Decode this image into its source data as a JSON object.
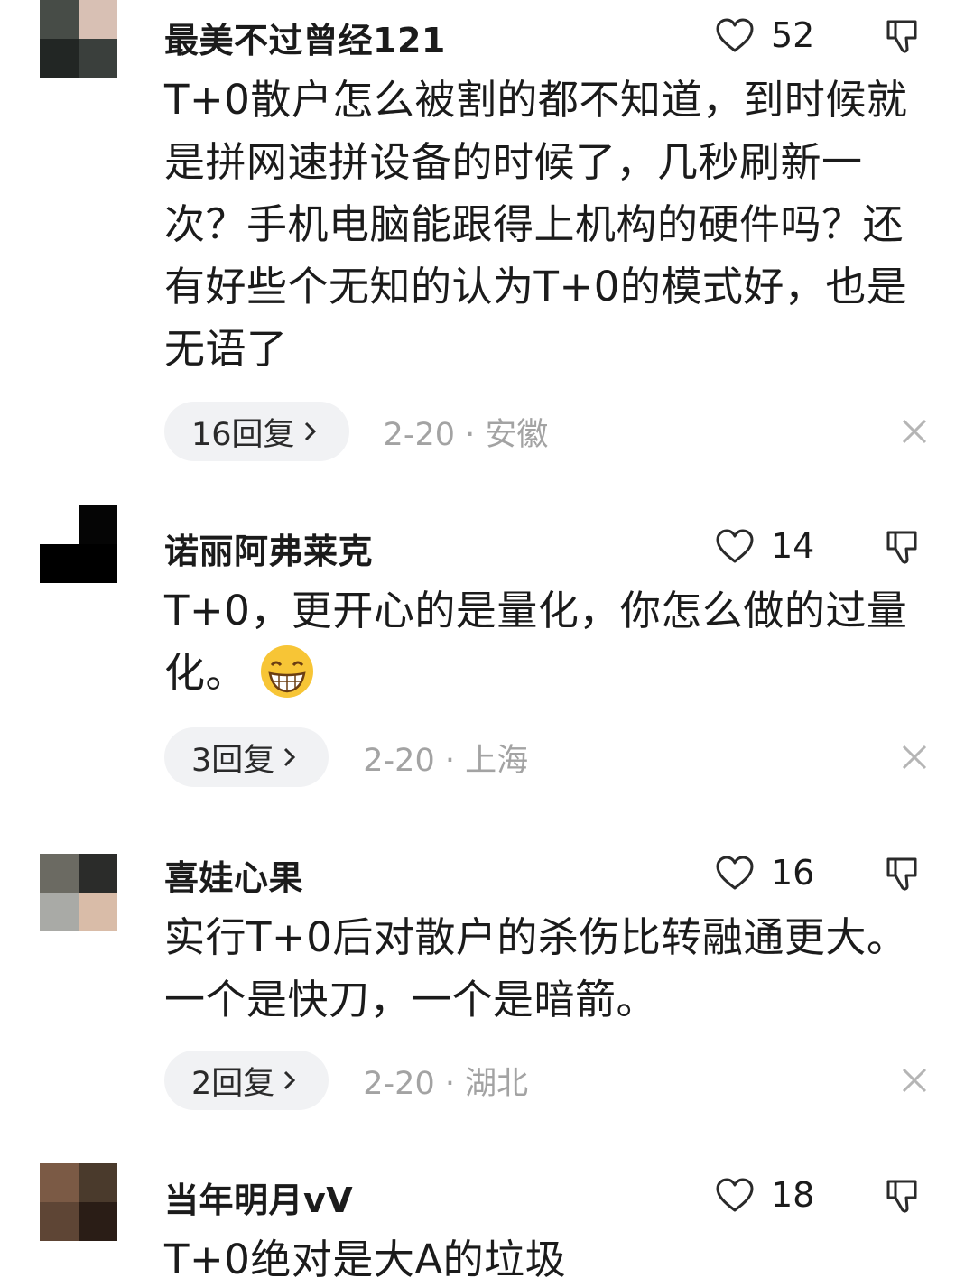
{
  "comments": [
    {
      "username": "最美不过曾经121",
      "likes": "52",
      "text": "T+0散户怎么被割的都不知道，到时候就是拼网速拼设备的时候了，几秒刷新一次？手机电脑能跟得上机构的硬件吗？还有好些个无知的认为T+0的模式好，也是无语了",
      "reply_label": "16回复",
      "meta": "2-20 · 安徽"
    },
    {
      "username": "诺丽阿弗莱克",
      "likes": "14",
      "text": "T+0，更开心的是量化，你怎么做的过量化。",
      "emoji": "grinning-face-emoji",
      "reply_label": "3回复",
      "meta": "2-20 · 上海"
    },
    {
      "username": "喜娃心果",
      "likes": "16",
      "text": "实行T+0后对散户的杀伤比转融通更大。一个是快刀，一个是暗箭。",
      "reply_label": "2回复",
      "meta": "2-20 · 湖北"
    },
    {
      "username": "当年明月vV",
      "likes": "18",
      "text": "T+0绝对是大A的垃圾"
    }
  ],
  "icons": {
    "like": "heart-outline-icon",
    "dislike": "thumbs-down-icon",
    "close": "close-icon",
    "chevron": "chevron-right-icon"
  },
  "colors": {
    "pill_background": "#f1f2f4",
    "meta_text": "#a3a3a3",
    "primary_text": "#1b1b1b"
  }
}
